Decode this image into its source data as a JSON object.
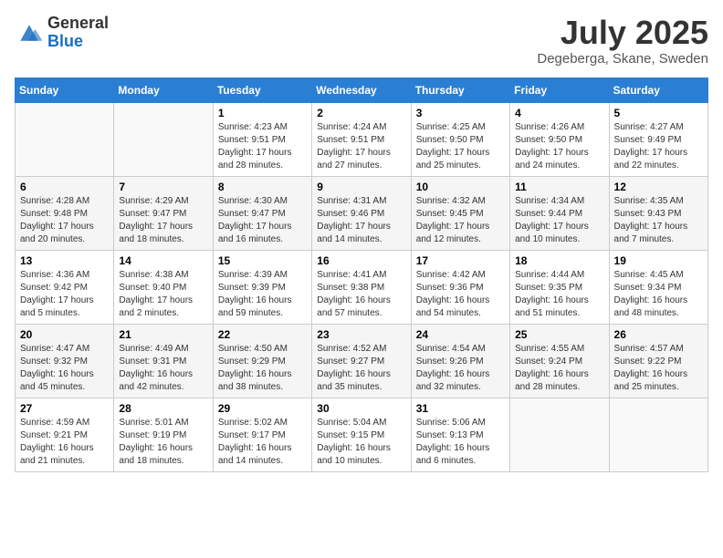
{
  "header": {
    "logo_general": "General",
    "logo_blue": "Blue",
    "month_year": "July 2025",
    "location": "Degeberga, Skane, Sweden"
  },
  "weekdays": [
    "Sunday",
    "Monday",
    "Tuesday",
    "Wednesday",
    "Thursday",
    "Friday",
    "Saturday"
  ],
  "weeks": [
    [
      {
        "day": "",
        "info": ""
      },
      {
        "day": "",
        "info": ""
      },
      {
        "day": "1",
        "info": "Sunrise: 4:23 AM\nSunset: 9:51 PM\nDaylight: 17 hours and 28 minutes."
      },
      {
        "day": "2",
        "info": "Sunrise: 4:24 AM\nSunset: 9:51 PM\nDaylight: 17 hours and 27 minutes."
      },
      {
        "day": "3",
        "info": "Sunrise: 4:25 AM\nSunset: 9:50 PM\nDaylight: 17 hours and 25 minutes."
      },
      {
        "day": "4",
        "info": "Sunrise: 4:26 AM\nSunset: 9:50 PM\nDaylight: 17 hours and 24 minutes."
      },
      {
        "day": "5",
        "info": "Sunrise: 4:27 AM\nSunset: 9:49 PM\nDaylight: 17 hours and 22 minutes."
      }
    ],
    [
      {
        "day": "6",
        "info": "Sunrise: 4:28 AM\nSunset: 9:48 PM\nDaylight: 17 hours and 20 minutes."
      },
      {
        "day": "7",
        "info": "Sunrise: 4:29 AM\nSunset: 9:47 PM\nDaylight: 17 hours and 18 minutes."
      },
      {
        "day": "8",
        "info": "Sunrise: 4:30 AM\nSunset: 9:47 PM\nDaylight: 17 hours and 16 minutes."
      },
      {
        "day": "9",
        "info": "Sunrise: 4:31 AM\nSunset: 9:46 PM\nDaylight: 17 hours and 14 minutes."
      },
      {
        "day": "10",
        "info": "Sunrise: 4:32 AM\nSunset: 9:45 PM\nDaylight: 17 hours and 12 minutes."
      },
      {
        "day": "11",
        "info": "Sunrise: 4:34 AM\nSunset: 9:44 PM\nDaylight: 17 hours and 10 minutes."
      },
      {
        "day": "12",
        "info": "Sunrise: 4:35 AM\nSunset: 9:43 PM\nDaylight: 17 hours and 7 minutes."
      }
    ],
    [
      {
        "day": "13",
        "info": "Sunrise: 4:36 AM\nSunset: 9:42 PM\nDaylight: 17 hours and 5 minutes."
      },
      {
        "day": "14",
        "info": "Sunrise: 4:38 AM\nSunset: 9:40 PM\nDaylight: 17 hours and 2 minutes."
      },
      {
        "day": "15",
        "info": "Sunrise: 4:39 AM\nSunset: 9:39 PM\nDaylight: 16 hours and 59 minutes."
      },
      {
        "day": "16",
        "info": "Sunrise: 4:41 AM\nSunset: 9:38 PM\nDaylight: 16 hours and 57 minutes."
      },
      {
        "day": "17",
        "info": "Sunrise: 4:42 AM\nSunset: 9:36 PM\nDaylight: 16 hours and 54 minutes."
      },
      {
        "day": "18",
        "info": "Sunrise: 4:44 AM\nSunset: 9:35 PM\nDaylight: 16 hours and 51 minutes."
      },
      {
        "day": "19",
        "info": "Sunrise: 4:45 AM\nSunset: 9:34 PM\nDaylight: 16 hours and 48 minutes."
      }
    ],
    [
      {
        "day": "20",
        "info": "Sunrise: 4:47 AM\nSunset: 9:32 PM\nDaylight: 16 hours and 45 minutes."
      },
      {
        "day": "21",
        "info": "Sunrise: 4:49 AM\nSunset: 9:31 PM\nDaylight: 16 hours and 42 minutes."
      },
      {
        "day": "22",
        "info": "Sunrise: 4:50 AM\nSunset: 9:29 PM\nDaylight: 16 hours and 38 minutes."
      },
      {
        "day": "23",
        "info": "Sunrise: 4:52 AM\nSunset: 9:27 PM\nDaylight: 16 hours and 35 minutes."
      },
      {
        "day": "24",
        "info": "Sunrise: 4:54 AM\nSunset: 9:26 PM\nDaylight: 16 hours and 32 minutes."
      },
      {
        "day": "25",
        "info": "Sunrise: 4:55 AM\nSunset: 9:24 PM\nDaylight: 16 hours and 28 minutes."
      },
      {
        "day": "26",
        "info": "Sunrise: 4:57 AM\nSunset: 9:22 PM\nDaylight: 16 hours and 25 minutes."
      }
    ],
    [
      {
        "day": "27",
        "info": "Sunrise: 4:59 AM\nSunset: 9:21 PM\nDaylight: 16 hours and 21 minutes."
      },
      {
        "day": "28",
        "info": "Sunrise: 5:01 AM\nSunset: 9:19 PM\nDaylight: 16 hours and 18 minutes."
      },
      {
        "day": "29",
        "info": "Sunrise: 5:02 AM\nSunset: 9:17 PM\nDaylight: 16 hours and 14 minutes."
      },
      {
        "day": "30",
        "info": "Sunrise: 5:04 AM\nSunset: 9:15 PM\nDaylight: 16 hours and 10 minutes."
      },
      {
        "day": "31",
        "info": "Sunrise: 5:06 AM\nSunset: 9:13 PM\nDaylight: 16 hours and 6 minutes."
      },
      {
        "day": "",
        "info": ""
      },
      {
        "day": "",
        "info": ""
      }
    ]
  ]
}
